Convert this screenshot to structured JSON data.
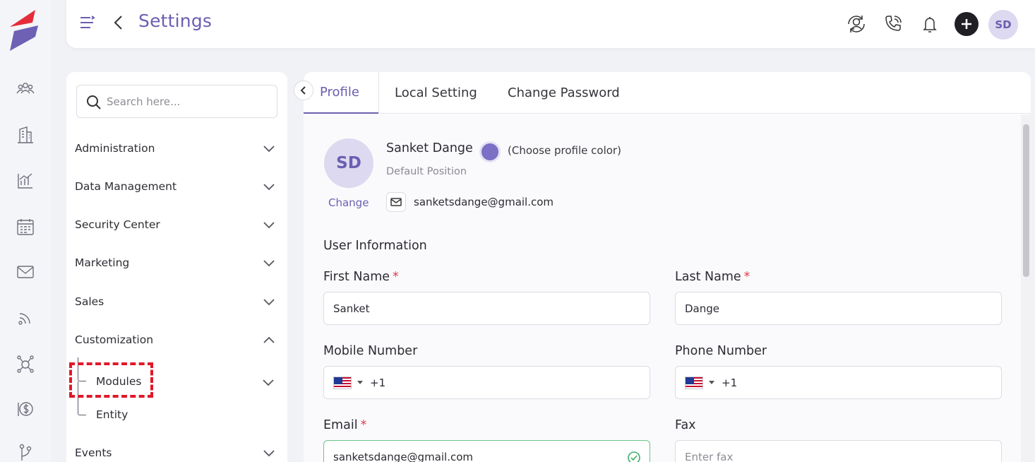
{
  "header": {
    "title": "Settings",
    "avatar_initials": "SD"
  },
  "rail": {
    "icons": [
      "users-icon",
      "building-icon",
      "analytics-icon",
      "calendar-icon",
      "mail-icon",
      "feed-icon",
      "network-icon",
      "dollar-icon",
      "branch-icon"
    ]
  },
  "nav": {
    "search_placeholder": "Search here...",
    "items": [
      {
        "label": "Administration",
        "expanded": false
      },
      {
        "label": "Data Management",
        "expanded": false
      },
      {
        "label": "Security Center",
        "expanded": false
      },
      {
        "label": "Marketing",
        "expanded": false
      },
      {
        "label": "Sales",
        "expanded": false
      },
      {
        "label": "Customization",
        "expanded": true
      },
      {
        "label": "Events",
        "expanded": false
      }
    ],
    "sub_items": [
      {
        "label": "Modules"
      },
      {
        "label": "Entity"
      }
    ]
  },
  "tabs": [
    {
      "label": "Profile",
      "active": true
    },
    {
      "label": "Local Setting",
      "active": false
    },
    {
      "label": "Change Password",
      "active": false
    }
  ],
  "profile": {
    "initials": "SD",
    "change_label": "Change",
    "name": "Sanket Dange",
    "color_hint": "(Choose profile color)",
    "profile_color": "#7b6fc6",
    "position": "Default Position",
    "email": "sanketsdange@gmail.com"
  },
  "form": {
    "section_title": "User Information",
    "first_name": {
      "label": "First Name",
      "required": "*",
      "value": "Sanket"
    },
    "last_name": {
      "label": "Last Name",
      "required": "*",
      "value": "Dange"
    },
    "mobile": {
      "label": "Mobile Number",
      "code": "+1"
    },
    "phone": {
      "label": "Phone Number",
      "code": "+1"
    },
    "email": {
      "label": "Email",
      "required": "*",
      "value": "sanketsdange@gmail.com"
    },
    "fax": {
      "label": "Fax",
      "placeholder": "Enter fax"
    }
  },
  "colors": {
    "accent": "#6a5fb0",
    "highlight": "#e1182a"
  }
}
